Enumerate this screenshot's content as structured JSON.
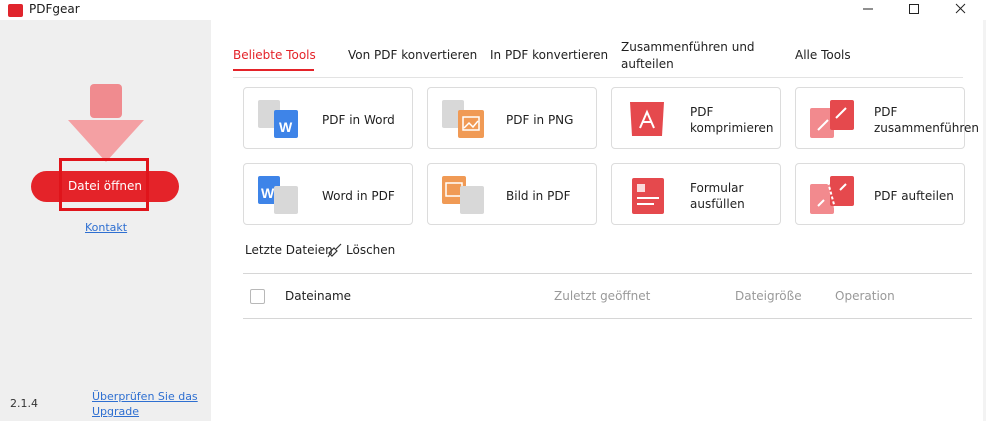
{
  "window": {
    "title": "PDFgear"
  },
  "sidebar": {
    "open_button": "Datei öffnen",
    "contact_link": "Kontakt",
    "version": "2.1.4",
    "upgrade_link": "Überprüfen Sie das Upgrade"
  },
  "tabs": [
    {
      "label": "Beliebte Tools",
      "active": true
    },
    {
      "label": "Von PDF konvertieren"
    },
    {
      "label": "In PDF konvertieren"
    },
    {
      "label": "Zusammenführen und aufteilen"
    },
    {
      "label": "Alle Tools"
    }
  ],
  "tools": [
    {
      "label": "PDF in Word",
      "icon": "pdf-to-word-icon"
    },
    {
      "label": "PDF in PNG",
      "icon": "pdf-to-png-icon"
    },
    {
      "label": "PDF komprimieren",
      "icon": "compress-pdf-icon"
    },
    {
      "label": "PDF zusammenführen",
      "icon": "merge-pdf-icon"
    },
    {
      "label": "Word in PDF",
      "icon": "word-to-pdf-icon"
    },
    {
      "label": "Bild in PDF",
      "icon": "image-to-pdf-icon"
    },
    {
      "label": "Formular ausfüllen",
      "icon": "fill-form-icon"
    },
    {
      "label": "PDF aufteilen",
      "icon": "split-pdf-icon"
    }
  ],
  "recent": {
    "title": "Letzte Dateien",
    "clear_label": "Löschen",
    "columns": [
      "Dateiname",
      "Zuletzt geöffnet",
      "Dateigröße",
      "Operation"
    ]
  },
  "colors": {
    "accent": "#e42329",
    "link": "#2e6fd1"
  }
}
